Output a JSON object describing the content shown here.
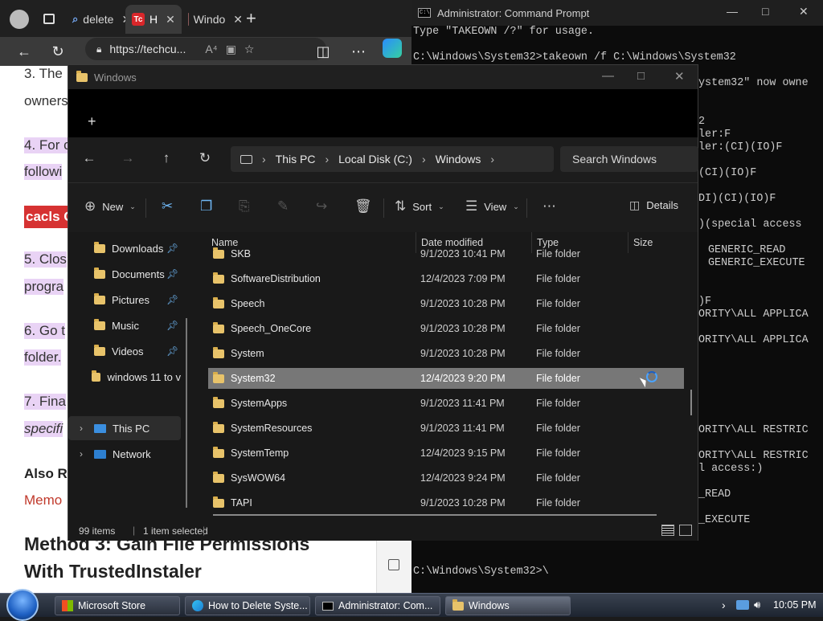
{
  "browser": {
    "tabs": [
      {
        "label": "delete",
        "icon": "search-icon"
      },
      {
        "label": "H",
        "icon": "techcult-favicon",
        "active": true
      },
      {
        "label": "Windo",
        "icon": "page-favicon"
      }
    ],
    "url": "https://techcu...",
    "url_icon": "lock-icon",
    "page_lines": [
      {
        "text": "3. The"
      },
      {
        "text": "owners"
      },
      {
        "text": "4. For c"
      },
      {
        "text": "followi"
      },
      {
        "text": "cacls C"
      },
      {
        "text": "5. Clos"
      },
      {
        "text": "progra"
      },
      {
        "text": "6. Go t"
      },
      {
        "text": "folder."
      },
      {
        "text": "7. Fina"
      },
      {
        "text": "specifi"
      },
      {
        "text": "Also R"
      },
      {
        "text": "Memo"
      }
    ],
    "heading_line1": "Method 3: Gain File Permissions",
    "heading_line2": "With TrustedInstaler"
  },
  "cmd": {
    "title": "Administrator: Command Prompt",
    "lines": [
      "Type \"TAKEOWN /?\" for usage.",
      "",
      "C:\\Windows\\System32>takeown /f C:\\Windows\\System32"
    ],
    "right_lines": [
      "ystem32\" now owne",
      "",
      "",
      "2",
      "ler:F",
      "ler:(CI)(IO)F",
      "",
      "(CI)(IO)F",
      "",
      "DI)(CI)(IO)F",
      "",
      ")(special access",
      "",
      "GENERIC_READ",
      "GENERIC_EXECUTE",
      "",
      "",
      ")F",
      "ORITY\\ALL APPLICA",
      "",
      "ORITY\\ALL APPLICA",
      "",
      "",
      "",
      "",
      "",
      "",
      "ORITY\\ALL RESTRIC",
      "",
      "ORITY\\ALL RESTRIC",
      "l access:)",
      "",
      "_READ",
      "",
      "_EXECUTE"
    ],
    "prompt": "C:\\Windows\\System32>\\"
  },
  "explorer": {
    "title": "Windows",
    "breadcrumb": [
      "This PC",
      "Local Disk (C:)",
      "Windows"
    ],
    "search_placeholder": "Search Windows",
    "commands": {
      "new": "New",
      "sort": "Sort",
      "view": "View",
      "details": "Details"
    },
    "nav": [
      {
        "label": "Downloads",
        "pinned": true
      },
      {
        "label": "Documents",
        "pinned": true
      },
      {
        "label": "Pictures",
        "pinned": true
      },
      {
        "label": "Music",
        "pinned": true
      },
      {
        "label": "Videos",
        "pinned": true
      },
      {
        "label": "windows 11 to v",
        "pinned": false
      },
      {
        "label": "This PC",
        "pinned": false
      },
      {
        "label": "Network",
        "pinned": false
      }
    ],
    "columns": [
      "Name",
      "Date modified",
      "Type",
      "Size"
    ],
    "rows": [
      {
        "name": "SKB",
        "date": "9/1/2023 10:41 PM",
        "type": "File folder"
      },
      {
        "name": "SoftwareDistribution",
        "date": "12/4/2023 7:09 PM",
        "type": "File folder"
      },
      {
        "name": "Speech",
        "date": "9/1/2023 10:28 PM",
        "type": "File folder"
      },
      {
        "name": "Speech_OneCore",
        "date": "9/1/2023 10:28 PM",
        "type": "File folder"
      },
      {
        "name": "System",
        "date": "9/1/2023 10:28 PM",
        "type": "File folder"
      },
      {
        "name": "System32",
        "date": "12/4/2023 9:20 PM",
        "type": "File folder",
        "selected": true
      },
      {
        "name": "SystemApps",
        "date": "9/1/2023 11:41 PM",
        "type": "File folder"
      },
      {
        "name": "SystemResources",
        "date": "9/1/2023 11:41 PM",
        "type": "File folder"
      },
      {
        "name": "SystemTemp",
        "date": "12/4/2023 9:15 PM",
        "type": "File folder"
      },
      {
        "name": "SysWOW64",
        "date": "12/4/2023 9:24 PM",
        "type": "File folder"
      },
      {
        "name": "TAPI",
        "date": "9/1/2023 10:28 PM",
        "type": "File folder"
      }
    ],
    "status": {
      "count": "99 items",
      "selected": "1 item selected"
    }
  },
  "taskbar": {
    "items": [
      {
        "label": "Microsoft Store",
        "icon": "store-icon"
      },
      {
        "label": "How to Delete Syste...",
        "icon": "edge-icon"
      },
      {
        "label": "Administrator: Com...",
        "icon": "cmd-icon"
      },
      {
        "label": "Windows",
        "icon": "folder-icon"
      }
    ],
    "clock": "10:05 PM"
  }
}
